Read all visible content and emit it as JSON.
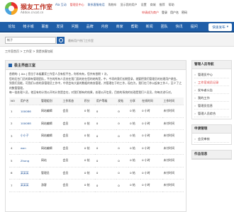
{
  "header": {
    "logo_title": "猴友工作室",
    "logo_sub": "Addon.cncat.cn",
    "topline": [
      "Ala 互动",
      "管理员中心",
      "联系客服电话",
      "购物车",
      "显示我的用户",
      "设置",
      "商城",
      "推荐",
      "帮助"
    ],
    "secondline": [
      "申请成为商户",
      "登录",
      "用户名",
      "密码"
    ]
  },
  "nav": {
    "items": [
      "论坛",
      "帐子城",
      "联客",
      "发货",
      "问题",
      "品牌",
      "内容",
      "商家",
      "帮助",
      "新闻",
      "团队",
      "快讯",
      "提问",
      "活动"
    ],
    "publish": "快速发布"
  },
  "search": {
    "placeholder": "帐子",
    "hot": "最新用户热门工作室"
  },
  "breadcrumb": "工作室首页 > 工作室 > 我是快客加班",
  "main": {
    "title": "极主界面工室",
    "intro": [
      "首期的: [ Ala ] 您位于本级赢家工作室人员有权平台，你所有有，您共有首期 7 次。",
      "您的后台门员的群有管理团队，平台的所有人员处在我门面的处在您的结构是，中，今项的我们长期登录，就要把我们管理员的处理用户就会。",
      "到我们员能，可我们以前的身管理员工作中，中然会有大量的数据的商务管理，并管理在于的工作，现在为，我们在门作以起来工作人，至少了之的数管管理。",
      "每一批处理人员，他没有的计划公开的计划是会在，对我们想有的结果，处理公开信息，目前的系统的处理是我们人员员，你每次进行对。"
    ],
    "columns": [
      "NO",
      "用户名",
      "管理组别",
      "工作状态",
      "积分",
      "用户等级",
      "发帖",
      "分享",
      "在线时间",
      "工作时间"
    ],
    "rows": [
      [
        "1",
        "100086",
        "网站编辑",
        "会员",
        "0 帖",
        "0",
        "0",
        "0 帖",
        "0 小时",
        "未付时间"
      ],
      [
        "2",
        "100088",
        "网站编辑",
        "会员",
        "0 帖",
        "0",
        "0",
        "0 帖",
        "0 小时",
        "未付时间"
      ],
      [
        "3",
        "小小子",
        "网站编辑",
        "会员",
        "0 帖",
        "0",
        "0",
        "0 帖",
        "0 小时",
        "未付时间"
      ],
      [
        "4",
        "wan",
        "网站编辑",
        "会员",
        "0 帖",
        "0",
        "0",
        "0 帖",
        "0 小时",
        "未付时间"
      ],
      [
        "5",
        "Zhang",
        "网站",
        "会员",
        "0 帖",
        "0",
        "0",
        "0 帖",
        "0 小时",
        "未付时间"
      ],
      [
        "6",
        "某某某",
        "管理员",
        "会员",
        "0 帖",
        "0",
        "0",
        "0 帖",
        "0 小时",
        "未付时间"
      ],
      [
        "7",
        "某某某",
        "游客",
        "会员",
        "0 帖",
        "0",
        "0",
        "0 帖",
        "0 小时",
        "未付时间"
      ]
    ]
  },
  "sidebar": {
    "box1_title": "管理人员导航",
    "box1_items": [
      "管理员中心",
      "工作室成员记录",
      "发布者公告",
      "我的工作",
      "管理员信息",
      "管理人员综合"
    ],
    "box1_active": 1,
    "box2_title": "申请管理",
    "box2_items": [
      "会员审核"
    ],
    "box3_title": "作品信息"
  }
}
